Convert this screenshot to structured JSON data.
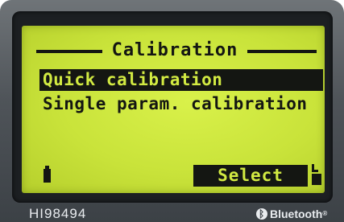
{
  "screen": {
    "title": "Calibration",
    "menu_items": [
      {
        "label": "Quick calibration",
        "selected": true
      },
      {
        "label": "Single param. calibration",
        "selected": false
      }
    ],
    "softkey": "Select"
  },
  "device": {
    "model": "HI98494",
    "bluetooth_label": "Bluetooth",
    "bluetooth_mark": "®"
  },
  "colors": {
    "lcd_background": "#cfe83e",
    "lcd_ink": "#141612",
    "device_body": "#4f5459"
  },
  "icons": {
    "left": "battery-icon",
    "right": "hook-icon",
    "logo": "bluetooth-icon"
  }
}
